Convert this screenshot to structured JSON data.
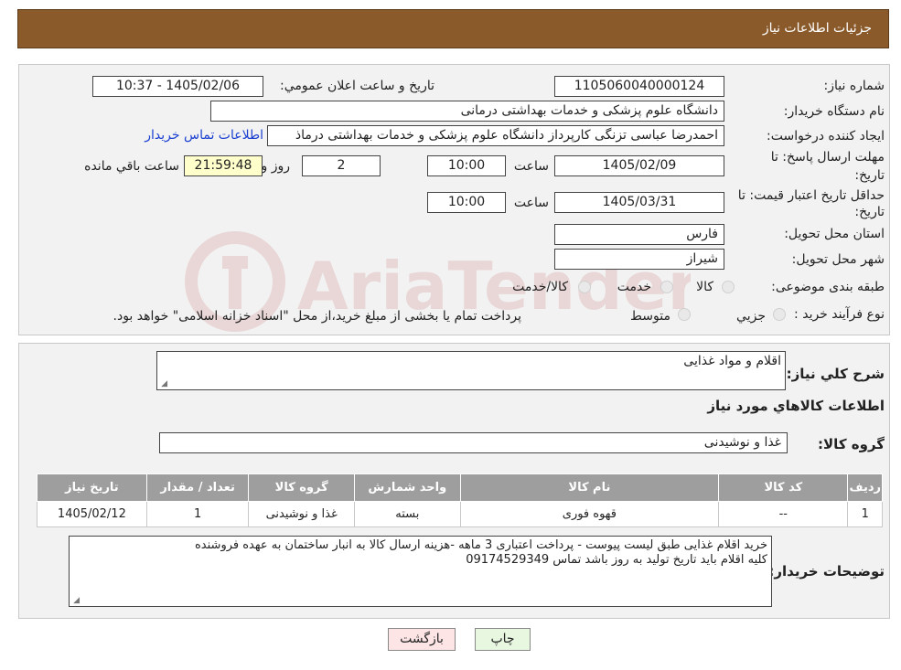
{
  "header": {
    "title": "جزئیات اطلاعات نیاز"
  },
  "form": {
    "need_number_label": "شماره نیاز:",
    "need_number": "1105060040000124",
    "announce_label": "تاریخ و ساعت اعلان عمومي:",
    "announce_value": "1405/02/06 - 10:37",
    "buyer_org_label": "نام دستگاه خريدار:",
    "buyer_org": "دانشگاه علوم پزشکی و خدمات بهداشتی درمانی",
    "creator_label": "ايجاد کننده درخواست:",
    "creator": "احمدرضا عباسی تزنگی کارپرداز دانشگاه علوم پزشکی و خدمات بهداشتی درماذ",
    "contact_link": "اطلاعات تماس خريدار",
    "deadline_label_1": "مهلت ارسال پاسخ: تا",
    "deadline_label_2": "تاريخ:",
    "deadline_date": "1405/02/09",
    "hour_label": "ساعت",
    "deadline_time": "10:00",
    "days_value": "2",
    "days_label": "روز و",
    "remaining_time": "21:59:48",
    "remaining_label": "ساعت باقي مانده",
    "validity_label_1": "حداقل تاريخ اعتبار قيمت: تا",
    "validity_label_2": "تاريخ:",
    "validity_date": "1405/03/31",
    "validity_time": "10:00",
    "province_label": "استان محل تحويل:",
    "province": "فارس",
    "city_label": "شهر محل تحويل:",
    "city": "شيراز",
    "category_label": "طبقه بندی موضوعی:",
    "category_options": [
      "کالا",
      "خدمت",
      "کالا/خدمت"
    ],
    "process_label": "نوع فرآيند خريد :",
    "process_options": [
      "جزيي",
      "متوسط"
    ],
    "process_note": "پرداخت تمام يا بخشی از مبلغ خريد،از محل \"اسناد خزانه اسلامی\" خواهد بود."
  },
  "summary": {
    "description_label": "شرح کلي نياز:",
    "description": "اقلام و مواد غذایی",
    "items_heading": "اطلاعات کالاهاي مورد نياز",
    "group_label": "گروه کالا:",
    "group_value": "غذا و نوشیدنی",
    "table": {
      "headers": [
        "رديف",
        "کد کالا",
        "نام کالا",
        "واحد شمارش",
        "گروه کالا",
        "تعداد / مقدار",
        "تاريخ نياز"
      ],
      "rows": [
        [
          "1",
          "--",
          "قهوه فوری",
          "بسته",
          "غذا و نوشیدنی",
          "1",
          "1405/02/12"
        ]
      ]
    },
    "notes_label": "توضيحات خريدار:",
    "notes_line1": "خرید اقلام غذایی طبق لیست پیوست - پرداخت  اعتباری 3 ماهه -هزینه ارسال کالا به انبار ساختمان به  عهده فروشنده",
    "notes_line2": "کلیه اقلام باید تاریخ تولید به روز باشد تماس 09174529349"
  },
  "buttons": {
    "print": "چاپ",
    "back": "بازگشت"
  },
  "colors": {
    "header_bg": "#8b5a2b",
    "table_header_bg": "#9e9e9e",
    "link": "#1a3fd1",
    "remaining_bg": "#ffffcc",
    "back_button_bg": "#fde5e5",
    "print_button_bg": "#e8f7e0",
    "watermark": "#d9a3a3"
  },
  "watermark": {
    "text": "AriaTender.neT"
  }
}
